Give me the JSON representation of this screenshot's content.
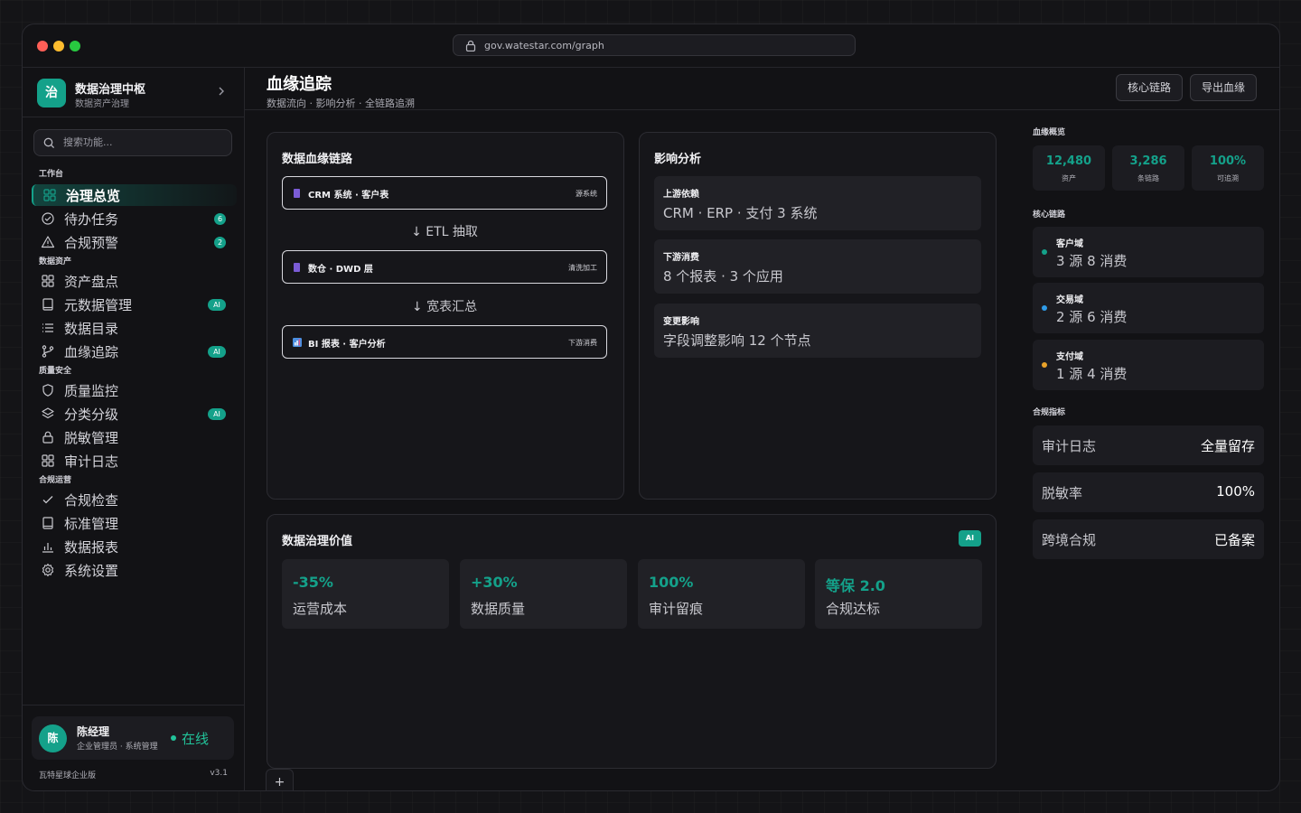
{
  "browser": {
    "url": "gov.watestar.com/graph"
  },
  "brand": {
    "logo": "治",
    "title": "数据治理中枢",
    "subtitle": "数据资产治理"
  },
  "search": {
    "placeholder": "搜索功能..."
  },
  "nav": {
    "groups": [
      {
        "label": "工作台",
        "items": [
          {
            "label": "治理总览",
            "icon": "grid-icon",
            "active": true
          },
          {
            "label": "待办任务",
            "icon": "check-circle-icon",
            "badge": "6"
          },
          {
            "label": "合规预警",
            "icon": "warning-icon",
            "badge": "2"
          }
        ]
      },
      {
        "label": "数据资产",
        "items": [
          {
            "label": "资产盘点",
            "icon": "grid-icon"
          },
          {
            "label": "元数据管理",
            "icon": "book-icon",
            "badge": "AI"
          },
          {
            "label": "数据目录",
            "icon": "list-icon"
          },
          {
            "label": "血缘追踪",
            "icon": "branch-icon",
            "badge": "AI"
          }
        ]
      },
      {
        "label": "质量安全",
        "items": [
          {
            "label": "质量监控",
            "icon": "shield-icon"
          },
          {
            "label": "分类分级",
            "icon": "layers-icon",
            "badge": "AI"
          },
          {
            "label": "脱敏管理",
            "icon": "lock-icon"
          },
          {
            "label": "审计日志",
            "icon": "grid-icon"
          }
        ]
      },
      {
        "label": "合规运营",
        "items": [
          {
            "label": "合规检查",
            "icon": "check-icon"
          },
          {
            "label": "标准管理",
            "icon": "book-icon"
          },
          {
            "label": "数据报表",
            "icon": "bar-chart-icon"
          },
          {
            "label": "系统设置",
            "icon": "gear-icon"
          }
        ]
      }
    ]
  },
  "user": {
    "avatar": "陈",
    "name": "陈经理",
    "role": "企业管理员 · 系统管理",
    "status": "在线"
  },
  "footer": {
    "edition": "瓦特星球企业版",
    "version": "v3.1"
  },
  "header": {
    "title": "血缘追踪",
    "subtitle": "数据流向 · 影响分析 · 全链路追溯",
    "buttons": [
      "核心链路",
      "导出血缘"
    ]
  },
  "lineage": {
    "title": "数据血缘链路",
    "nodes": [
      {
        "label": "CRM 系统 · 客户表",
        "tag": "源系统",
        "color": "#7b5cd6"
      },
      {
        "label": "数仓 · DWD 层",
        "tag": "清洗加工",
        "color": "#7b5cd6"
      },
      {
        "label": "BI 报表 · 客户分析",
        "tag": "下游消费",
        "color": "#4a8fe0"
      }
    ],
    "arrows": [
      "↓ ETL 抽取",
      "↓ 宽表汇总"
    ]
  },
  "impact": {
    "title": "影响分析",
    "items": [
      {
        "label": "上游依赖",
        "value": "CRM · ERP · 支付 3 系统"
      },
      {
        "label": "下游消费",
        "value": "8 个报表 · 3 个应用"
      },
      {
        "label": "变更影响",
        "value": "字段调整影响 12 个节点"
      }
    ]
  },
  "value": {
    "title": "数据治理价值",
    "chip": "AI",
    "tiles": [
      {
        "num": "-35%",
        "label": "运营成本"
      },
      {
        "num": "+30%",
        "label": "数据质量"
      },
      {
        "num": "100%",
        "label": "审计留痕"
      },
      {
        "num": "等保 2.0",
        "label": "合规达标"
      }
    ]
  },
  "tabs": {
    "add": "+"
  },
  "right": {
    "overview_label": "血缘概览",
    "stats": [
      {
        "num": "12,480",
        "label": "资产"
      },
      {
        "num": "3,286",
        "label": "条链路"
      },
      {
        "num": "100%",
        "label": "可追溯"
      }
    ],
    "chains_label": "核心链路",
    "chains": [
      {
        "title": "客户域",
        "value": "3 源 8 消费",
        "color": "#14a18a"
      },
      {
        "title": "交易域",
        "value": "2 源 6 消费",
        "color": "#2f9be8"
      },
      {
        "title": "支付域",
        "value": "1 源 4 消费",
        "color": "#e8a22a"
      }
    ],
    "metrics_label": "合规指标",
    "metrics": [
      {
        "label": "审计日志",
        "value": "全量留存"
      },
      {
        "label": "脱敏率",
        "value": "100%"
      },
      {
        "label": "跨境合规",
        "value": "已备案"
      }
    ]
  },
  "colors": {
    "accent": "#14a18a"
  }
}
